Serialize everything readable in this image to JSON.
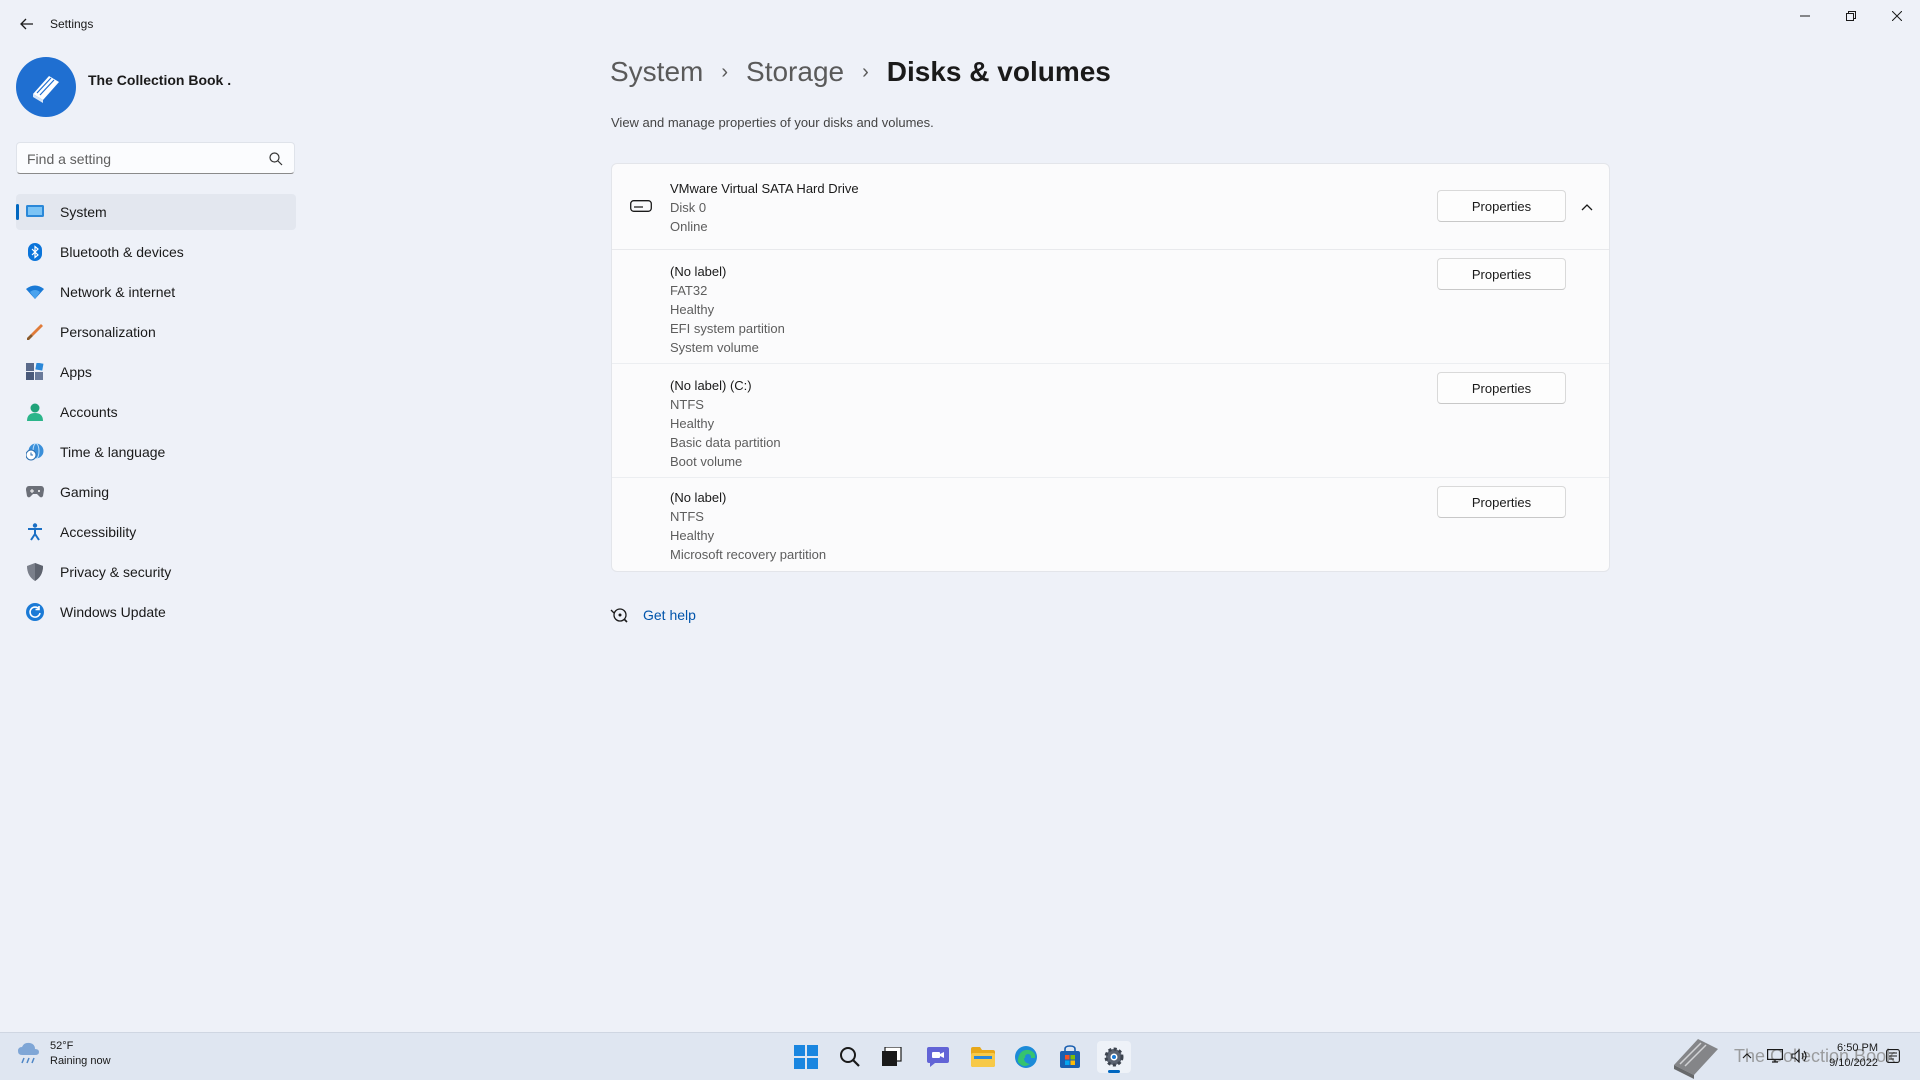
{
  "window": {
    "app_title": "Settings"
  },
  "profile": {
    "name": "The Collection Book ."
  },
  "search": {
    "placeholder": "Find a setting"
  },
  "nav": {
    "items": [
      {
        "label": "System"
      },
      {
        "label": "Bluetooth & devices"
      },
      {
        "label": "Network & internet"
      },
      {
        "label": "Personalization"
      },
      {
        "label": "Apps"
      },
      {
        "label": "Accounts"
      },
      {
        "label": "Time & language"
      },
      {
        "label": "Gaming"
      },
      {
        "label": "Accessibility"
      },
      {
        "label": "Privacy & security"
      },
      {
        "label": "Windows Update"
      }
    ],
    "active": "System"
  },
  "breadcrumb": {
    "items": [
      "System",
      "Storage",
      "Disks & volumes"
    ],
    "separator": "›"
  },
  "page": {
    "subtitle": "View and manage properties of your disks and volumes."
  },
  "disk": {
    "name": "VMware Virtual SATA Hard Drive",
    "number": "Disk 0",
    "status": "Online",
    "properties_label": "Properties",
    "volumes": [
      {
        "lines": [
          "(No label)",
          "FAT32",
          "Healthy",
          "EFI system partition",
          "System volume"
        ],
        "properties_label": "Properties"
      },
      {
        "lines": [
          "(No label) (C:)",
          "NTFS",
          "Healthy",
          "Basic data partition",
          "Boot volume"
        ],
        "properties_label": "Properties"
      },
      {
        "lines": [
          "(No label)",
          "NTFS",
          "Healthy",
          "Microsoft recovery partition"
        ],
        "properties_label": "Properties"
      }
    ]
  },
  "help": {
    "label": "Get help"
  },
  "taskbar": {
    "weather_temp": "52°F",
    "weather_desc": "Raining now",
    "time": "6:50 PM",
    "date": "9/10/2022",
    "watermark": "The Collection Book"
  },
  "colors": {
    "accent": "#0067c0",
    "background": "#eef1f8",
    "link": "#0054ab"
  }
}
